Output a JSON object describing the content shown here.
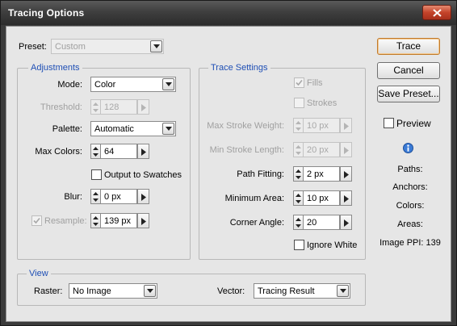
{
  "window": {
    "title": "Tracing Options"
  },
  "preset": {
    "label": "Preset:",
    "value": "Custom"
  },
  "adjustments": {
    "legend": "Adjustments",
    "mode": {
      "label": "Mode:",
      "value": "Color"
    },
    "threshold": {
      "label": "Threshold:",
      "value": "128"
    },
    "palette": {
      "label": "Palette:",
      "value": "Automatic"
    },
    "max_colors": {
      "label": "Max Colors:",
      "value": "64"
    },
    "output_to_swatches": {
      "label": "Output to Swatches",
      "checked": false
    },
    "blur": {
      "label": "Blur:",
      "value": "0 px"
    },
    "resample": {
      "label": "Resample:",
      "value": "139 px",
      "checked": true
    }
  },
  "trace_settings": {
    "legend": "Trace Settings",
    "fills": {
      "label": "Fills",
      "checked": true
    },
    "strokes": {
      "label": "Strokes",
      "checked": false
    },
    "max_stroke_weight": {
      "label": "Max Stroke Weight:",
      "value": "10 px"
    },
    "min_stroke_length": {
      "label": "Min Stroke Length:",
      "value": "20 px"
    },
    "path_fitting": {
      "label": "Path Fitting:",
      "value": "2 px"
    },
    "minimum_area": {
      "label": "Minimum Area:",
      "value": "10 px"
    },
    "corner_angle": {
      "label": "Corner Angle:",
      "value": "20"
    },
    "ignore_white": {
      "label": "Ignore White",
      "checked": false
    }
  },
  "view": {
    "legend": "View",
    "raster": {
      "label": "Raster:",
      "value": "No Image"
    },
    "vector": {
      "label": "Vector:",
      "value": "Tracing Result"
    }
  },
  "buttons": {
    "trace": "Trace",
    "cancel": "Cancel",
    "save_preset": "Save Preset..."
  },
  "preview": {
    "label": "Preview",
    "checked": false
  },
  "info": {
    "paths": "Paths:",
    "anchors": "Anchors:",
    "colors": "Colors:",
    "areas": "Areas:",
    "image_ppi": "Image PPI: 139"
  },
  "colors": {
    "accent": "#1f4fb5",
    "dialog_bg": "#e6e6e6",
    "title_bar": "#3f3f3f",
    "close_button": "#c4432a"
  }
}
